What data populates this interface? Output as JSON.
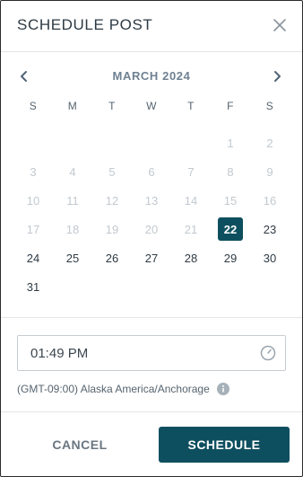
{
  "dialog": {
    "title": "SCHEDULE POST",
    "close_icon": "close-icon"
  },
  "calendar": {
    "month_label": "MARCH 2024",
    "prev_icon": "chevron-left-icon",
    "next_icon": "chevron-right-icon",
    "weekdays": [
      "S",
      "M",
      "T",
      "W",
      "T",
      "F",
      "S"
    ],
    "leading_blanks": 5,
    "days": [
      {
        "label": "1",
        "state": "muted"
      },
      {
        "label": "2",
        "state": "muted"
      },
      {
        "label": "3",
        "state": "muted"
      },
      {
        "label": "4",
        "state": "muted"
      },
      {
        "label": "5",
        "state": "muted"
      },
      {
        "label": "6",
        "state": "muted"
      },
      {
        "label": "7",
        "state": "muted"
      },
      {
        "label": "8",
        "state": "muted"
      },
      {
        "label": "9",
        "state": "muted"
      },
      {
        "label": "10",
        "state": "muted"
      },
      {
        "label": "11",
        "state": "muted"
      },
      {
        "label": "12",
        "state": "muted"
      },
      {
        "label": "13",
        "state": "muted"
      },
      {
        "label": "14",
        "state": "muted"
      },
      {
        "label": "15",
        "state": "muted"
      },
      {
        "label": "16",
        "state": "muted"
      },
      {
        "label": "17",
        "state": "muted"
      },
      {
        "label": "18",
        "state": "muted"
      },
      {
        "label": "19",
        "state": "muted"
      },
      {
        "label": "20",
        "state": "muted"
      },
      {
        "label": "21",
        "state": "muted"
      },
      {
        "label": "22",
        "state": "selected"
      },
      {
        "label": "23",
        "state": "active"
      },
      {
        "label": "24",
        "state": "active"
      },
      {
        "label": "25",
        "state": "active"
      },
      {
        "label": "26",
        "state": "active"
      },
      {
        "label": "27",
        "state": "active"
      },
      {
        "label": "28",
        "state": "active"
      },
      {
        "label": "29",
        "state": "active"
      },
      {
        "label": "30",
        "state": "active"
      },
      {
        "label": "31",
        "state": "active"
      }
    ]
  },
  "time": {
    "value": "01:49 PM",
    "icon": "clock-icon"
  },
  "timezone": {
    "text": "(GMT-09:00) Alaska America/Anchorage",
    "icon": "info-icon"
  },
  "actions": {
    "cancel_label": "CANCEL",
    "schedule_label": "SCHEDULE"
  },
  "colors": {
    "accent": "#0e4f5f",
    "muted_day": "#c2c9cf",
    "text": "#2f3b44"
  }
}
